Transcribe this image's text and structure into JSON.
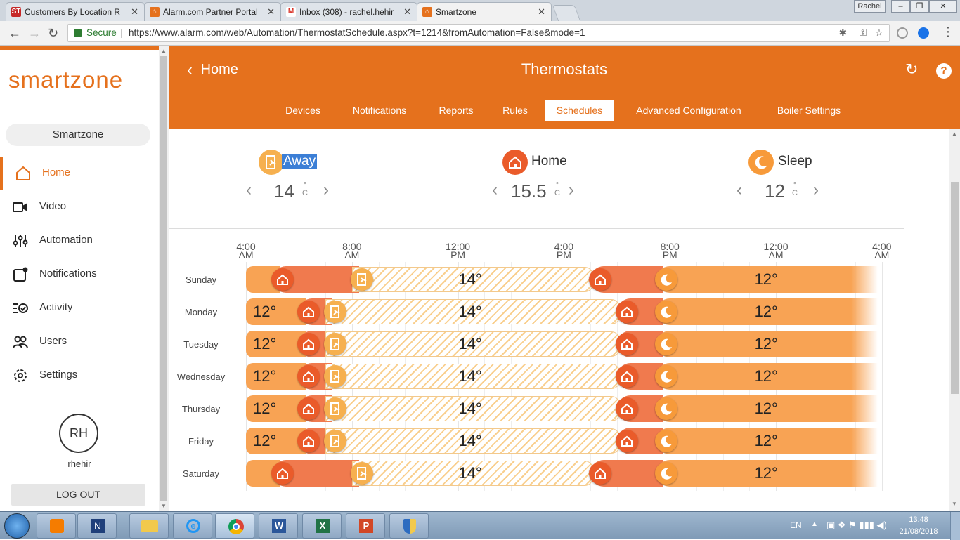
{
  "browser": {
    "tabs": [
      {
        "label": "Customers By Location R",
        "fav": "ST",
        "color": "#c62828"
      },
      {
        "label": "Alarm.com Partner Portal",
        "fav": "",
        "color": "#e5711d"
      },
      {
        "label": "Inbox (308) - rachel.hehir",
        "fav": "M",
        "color": "#d93025"
      },
      {
        "label": "Smartzone",
        "fav": "",
        "color": "#e5711d"
      }
    ],
    "user_chip": "Rachel",
    "secure_label": "Secure",
    "url": "https://www.alarm.com/web/Automation/ThermostatSchedule.aspx?t=1214&fromAutomation=False&mode=1"
  },
  "sidebar": {
    "logo": "smartzone",
    "account": "Smartzone",
    "items": [
      {
        "label": "Home",
        "icon": "home-icon"
      },
      {
        "label": "Video",
        "icon": "video-icon"
      },
      {
        "label": "Automation",
        "icon": "sliders-icon"
      },
      {
        "label": "Notifications",
        "icon": "notification-icon"
      },
      {
        "label": "Activity",
        "icon": "activity-icon"
      },
      {
        "label": "Users",
        "icon": "users-icon"
      },
      {
        "label": "Settings",
        "icon": "gear-icon"
      }
    ],
    "avatar_initials": "RH",
    "username": "rhehir",
    "logout": "LOG OUT"
  },
  "header": {
    "back_label": "Home",
    "title": "Thermostats",
    "tabs": [
      "Devices",
      "Notifications",
      "Reports",
      "Rules",
      "Schedules",
      "Advanced Configuration",
      "Boiler Settings"
    ],
    "active_tab": "Schedules"
  },
  "modes": [
    {
      "name": "Away",
      "temp": "14",
      "unit_top": "°",
      "unit_bottom": "C",
      "color": "#f6b04f",
      "icon": "away-icon"
    },
    {
      "name": "Home",
      "temp": "15.5",
      "unit_top": "°",
      "unit_bottom": "C",
      "color": "#ea5b2a",
      "icon": "home-icon"
    },
    {
      "name": "Sleep",
      "temp": "12",
      "unit_top": "°",
      "unit_bottom": "C",
      "color": "#f79a3a",
      "icon": "sleep-icon"
    }
  ],
  "schedule": {
    "ticks": [
      {
        "top": "4:00",
        "bottom": "AM"
      },
      {
        "top": "8:00",
        "bottom": "AM"
      },
      {
        "top": "12:00",
        "bottom": "PM"
      },
      {
        "top": "4:00",
        "bottom": "PM"
      },
      {
        "top": "8:00",
        "bottom": "PM"
      },
      {
        "top": "12:00",
        "bottom": "AM"
      },
      {
        "top": "4:00",
        "bottom": "AM"
      }
    ],
    "days": [
      {
        "name": "Sunday",
        "start_label": "",
        "home_start": 5.0,
        "away_start": 8.0,
        "home2_start": 17.0,
        "sleep_start": 19.5,
        "away_temp": "14°",
        "sleep_temp": "12°"
      },
      {
        "name": "Monday",
        "start_label": "12°",
        "home_start": 6.0,
        "away_start": 7.0,
        "home2_start": 18.0,
        "sleep_start": 19.5,
        "away_temp": "14°",
        "sleep_temp": "12°"
      },
      {
        "name": "Tuesday",
        "start_label": "12°",
        "home_start": 6.0,
        "away_start": 7.0,
        "home2_start": 18.0,
        "sleep_start": 19.5,
        "away_temp": "14°",
        "sleep_temp": "12°"
      },
      {
        "name": "Wednesday",
        "start_label": "12°",
        "home_start": 6.0,
        "away_start": 7.0,
        "home2_start": 18.0,
        "sleep_start": 19.5,
        "away_temp": "14°",
        "sleep_temp": "12°"
      },
      {
        "name": "Thursday",
        "start_label": "12°",
        "home_start": 6.0,
        "away_start": 7.0,
        "home2_start": 18.0,
        "sleep_start": 19.5,
        "away_temp": "14°",
        "sleep_temp": "12°"
      },
      {
        "name": "Friday",
        "start_label": "12°",
        "home_start": 6.0,
        "away_start": 7.0,
        "home2_start": 18.0,
        "sleep_start": 19.5,
        "away_temp": "14°",
        "sleep_temp": "12°"
      },
      {
        "name": "Saturday",
        "start_label": "",
        "home_start": 5.0,
        "away_start": 8.0,
        "home2_start": 17.0,
        "sleep_start": 19.5,
        "away_temp": "14°",
        "sleep_temp": "12°"
      }
    ]
  },
  "taskbar": {
    "lang": "EN",
    "time": "13:48",
    "date": "21/08/2018"
  }
}
